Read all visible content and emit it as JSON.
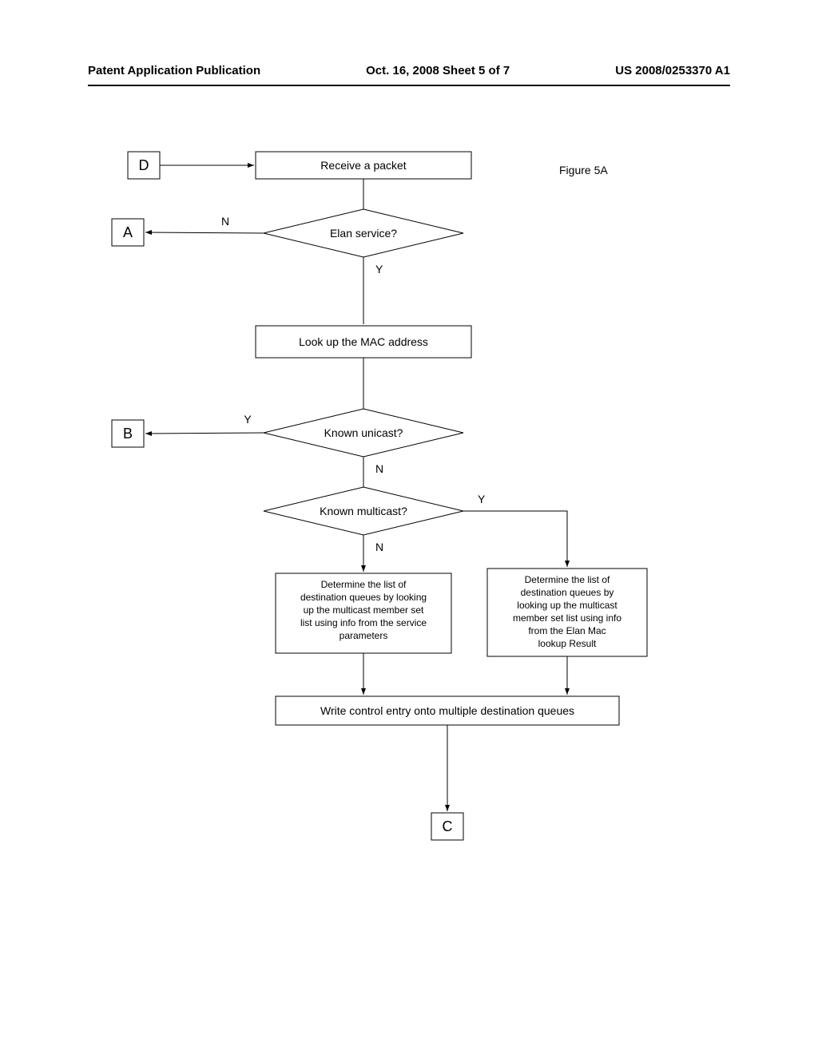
{
  "header": {
    "left": "Patent Application Publication",
    "center": "Oct. 16, 2008  Sheet 5 of 7",
    "right": "US 2008/0253370 A1"
  },
  "figure_label": "Figure 5A",
  "connectors": {
    "D": "D",
    "A": "A",
    "B": "B",
    "C": "C"
  },
  "step1": "Receive a packet",
  "decision1": "Elan service?",
  "step2": "Look up the MAC address",
  "decision2": "Known unicast?",
  "decision3": "Known multicast?",
  "step3": {
    "l1": "Determine the list of",
    "l2": "destination queues by looking",
    "l3": "up the multicast  member set",
    "l4": "list using info from the service",
    "l5": "parameters"
  },
  "step4": {
    "l1": "Determine the list of",
    "l2": "destination queues by",
    "l3": "looking up the multicast",
    "l4": "member set list using info",
    "l5": "from the Elan Mac",
    "l6": "lookup Result"
  },
  "step5": "Write control entry onto multiple destination queues",
  "labels": {
    "Y": "Y",
    "N": "N"
  }
}
